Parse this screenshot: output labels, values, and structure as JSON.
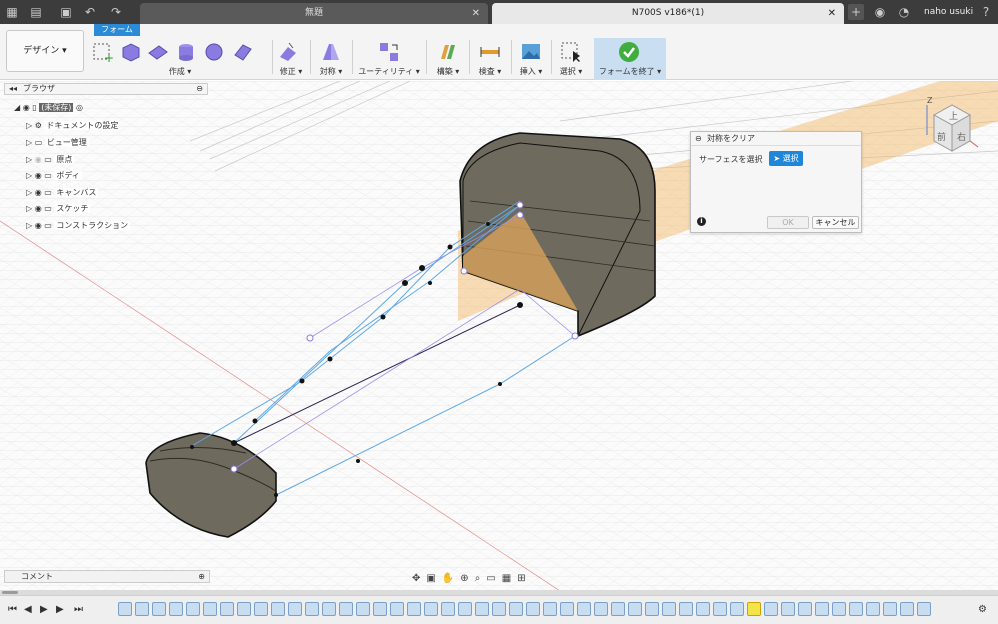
{
  "title_bar": {
    "tabs": [
      {
        "label": "無題",
        "active": false
      },
      {
        "label": "N700S v186*(1)",
        "active": true
      }
    ],
    "user_name": "naho usuki"
  },
  "toolbar": {
    "workspace_label": "デザイン ▾",
    "active_tab": "フォーム",
    "groups": [
      {
        "label": "作成 ▾"
      },
      {
        "label": "修正 ▾"
      },
      {
        "label": "対称 ▾"
      },
      {
        "label": "ユーティリティ ▾"
      },
      {
        "label": "構築 ▾"
      },
      {
        "label": "検査 ▾"
      },
      {
        "label": "挿入 ▾"
      },
      {
        "label": "選択 ▾"
      },
      {
        "label": "フォームを終了 ▾"
      }
    ]
  },
  "browser": {
    "title": "ブラウザ",
    "root_label": "(未保存)",
    "items": [
      {
        "label": "ドキュメントの設定"
      },
      {
        "label": "ビュー管理"
      },
      {
        "label": "原点"
      },
      {
        "label": "ボディ"
      },
      {
        "label": "キャンバス"
      },
      {
        "label": "スケッチ"
      },
      {
        "label": "コンストラクション"
      }
    ]
  },
  "dialog": {
    "title": "対称をクリア",
    "select_label": "サーフェスを選択",
    "select_button": "選択",
    "ok": "OK",
    "cancel": "キャンセル"
  },
  "viewcube": {
    "top": "上",
    "front": "前",
    "right": "右",
    "axis_z": "Z"
  },
  "comments": {
    "label": "コメント"
  },
  "colors": {
    "accent": "#1f86d8",
    "form_body": "#6f6a5e",
    "plane": "#f2b35e"
  }
}
